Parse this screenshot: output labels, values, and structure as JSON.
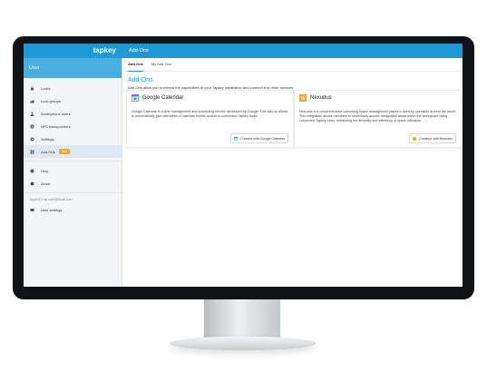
{
  "app": {
    "logo": "tapkey",
    "header_title": "Add-Ons",
    "user_label": "User"
  },
  "sidebar": {
    "items": [
      {
        "label": "Locks",
        "icon": "lock-icon"
      },
      {
        "label": "Lock groups",
        "icon": "lock-group-icon"
      },
      {
        "label": "Smartphone users",
        "icon": "person-icon"
      },
      {
        "label": "NFC transponders",
        "icon": "nfc-icon"
      },
      {
        "label": "Settings",
        "icon": "gear-icon"
      },
      {
        "label": "Add-Ons",
        "icon": "grid-icon",
        "badge": "New",
        "active": true
      }
    ],
    "help": {
      "label": "Help",
      "icon": "help-icon"
    },
    "about": {
      "label": "About",
      "icon": "info-icon"
    },
    "signed_in": "Signed in as user@email.com",
    "user_settings": {
      "label": "User settings",
      "icon": "user-card-icon"
    }
  },
  "tabs": [
    {
      "label": "Add-Ons",
      "active": true
    },
    {
      "label": "My Add-Ons",
      "active": false
    }
  ],
  "page": {
    "title": "Add-Ons",
    "intro": "Add-Ons allow you to extend the capabilities of your Tapkey installation and connect it to other services."
  },
  "cards": [
    {
      "title": "Google Calendar",
      "icon": "google-calendar-icon",
      "description": "Google Calendar is a time management and scheduling service developed by Google. This add-on allows to automatically give attendees of calendar events access to connected Tapkey locks.",
      "button": "Connect with Google Calendar",
      "button_icon": "google-calendar-small-icon"
    },
    {
      "title": "Nexudus",
      "icon": "nexudus-icon",
      "description": "Nexudus is a comprehensive coworking space management platform used by operators around the world. This integration allows members to seamlessly access designated areas within the workspace using connected Tapkey locks, enhancing the flexibility and efficiency of space utilization.",
      "button": "Continue with Nexudus",
      "button_icon": "nexudus-small-icon"
    }
  ],
  "colors": {
    "accent": "#1d9ad6",
    "user_bar": "#4aaee0",
    "badge": "#f5a623",
    "nexudus": "#f5a623"
  }
}
